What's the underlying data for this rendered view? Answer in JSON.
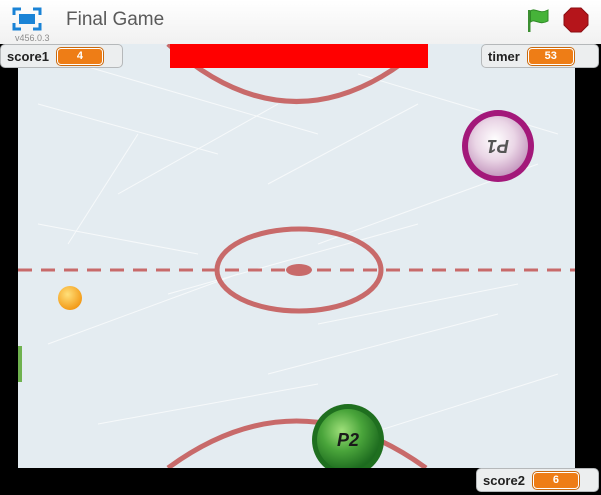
{
  "window": {
    "title": "Final Game",
    "version": "v456.0.3"
  },
  "monitors": {
    "score1": {
      "label": "score1",
      "value": "4"
    },
    "timer": {
      "label": "timer",
      "value": "53"
    },
    "score2": {
      "label": "score2",
      "value": "6"
    }
  },
  "sprites": {
    "player1": {
      "label": "P1",
      "color": "#a3187a"
    },
    "player2": {
      "label": "P2",
      "color": "#2e8d2a"
    }
  },
  "colors": {
    "top_goal": "#ff0000",
    "bottom_goal": "#0040ff",
    "rink_lines": "#c86a6a",
    "puck": "#f7a21e",
    "flag": "#46b339",
    "stop": "#b5151b"
  },
  "icons": [
    "fullscreen-icon",
    "green-flag-icon",
    "stop-sign-icon"
  ]
}
